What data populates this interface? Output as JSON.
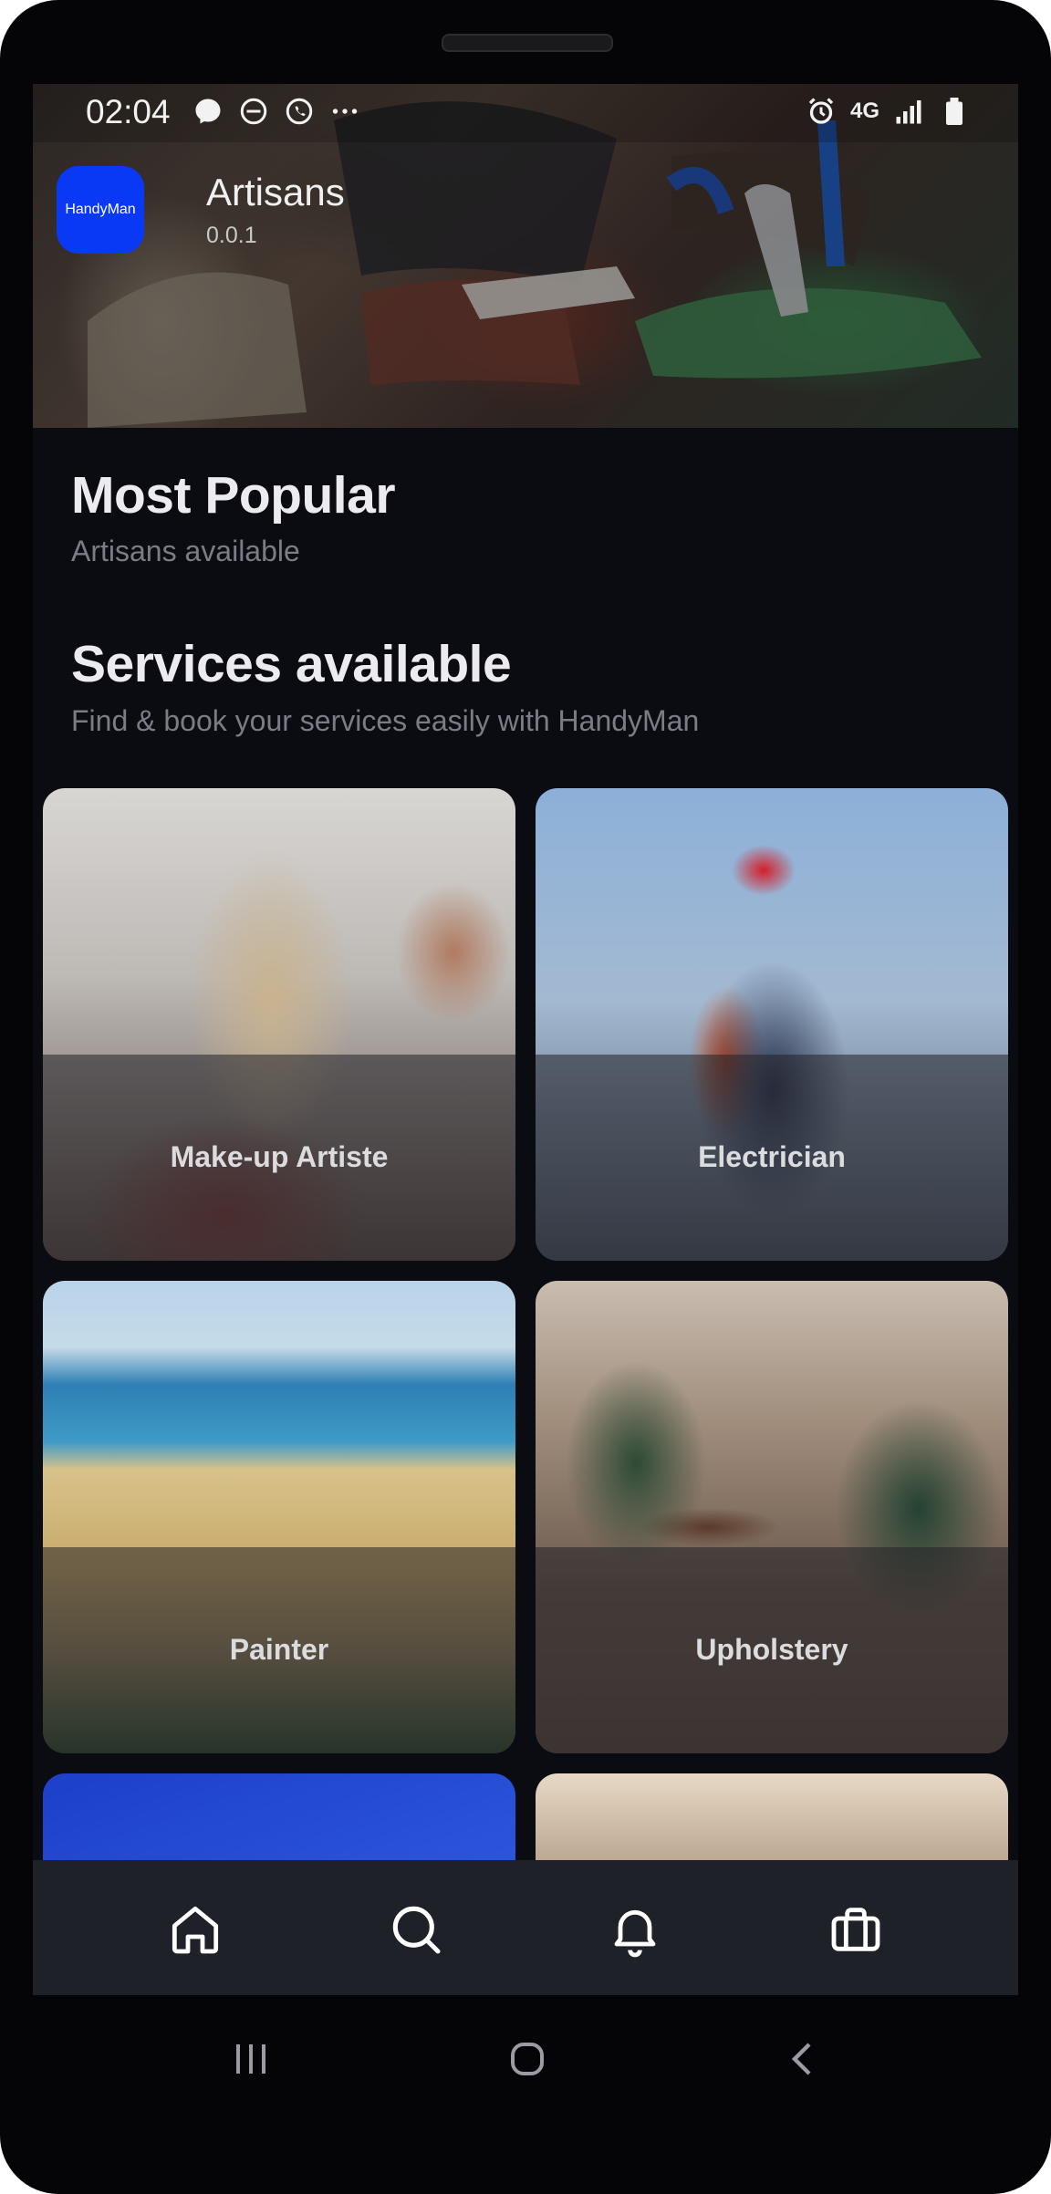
{
  "status_bar": {
    "time": "02:04",
    "network": "4G",
    "left_icons": [
      "messenger-icon",
      "do-not-disturb-icon",
      "whatsapp-icon",
      "more-dots-icon"
    ],
    "right_icons": [
      "alarm-icon",
      "signal-icon",
      "battery-icon"
    ]
  },
  "header": {
    "logo_text": "HandyMan",
    "app_name": "Artisans",
    "version": "0.0.1"
  },
  "most_popular": {
    "title": "Most Popular",
    "subtitle": "Artisans available"
  },
  "services": {
    "title": "Services available",
    "subtitle": "Find & book your services easily with HandyMan",
    "items": [
      {
        "label": "Make-up Artiste"
      },
      {
        "label": "Electrician"
      },
      {
        "label": "Painter"
      },
      {
        "label": "Upholstery"
      },
      {
        "label": ""
      },
      {
        "label": ""
      }
    ]
  },
  "bottom_nav": {
    "items": [
      "home-icon",
      "search-icon",
      "bell-icon",
      "briefcase-icon"
    ],
    "accent_color": "#ffffff",
    "background": "#1f2128"
  },
  "system_nav": {
    "items": [
      "recents-icon",
      "home-circle-icon",
      "back-icon"
    ]
  },
  "colors": {
    "screen_background": "#0b0b12",
    "logo_blue": "#0a39f5",
    "title_text": "#ecebef",
    "subtitle_text": "#7c7c86"
  }
}
